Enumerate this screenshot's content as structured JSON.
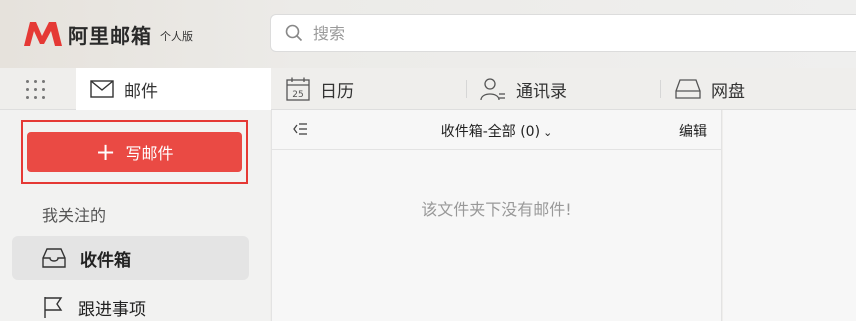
{
  "brand": {
    "name": "阿里邮箱",
    "edition": "个人版",
    "logo_color": "#e53935"
  },
  "search": {
    "placeholder": "搜索"
  },
  "tabs": [
    {
      "label": "邮件",
      "icon": "mail-icon",
      "active": true
    },
    {
      "label": "日历",
      "icon": "calendar-icon",
      "calendar_day": "25"
    },
    {
      "label": "通讯录",
      "icon": "contacts-icon"
    },
    {
      "label": "网盘",
      "icon": "drive-icon"
    }
  ],
  "sidebar": {
    "compose_label": "写邮件",
    "section_title": "我关注的",
    "items": [
      {
        "label": "收件箱",
        "icon": "inbox-icon",
        "active": true
      },
      {
        "label": "跟进事项",
        "icon": "flag-icon"
      }
    ]
  },
  "list": {
    "folder_title": "收件箱-全部 (0)",
    "edit_label": "编辑",
    "empty_message": "该文件夹下没有邮件!"
  },
  "colors": {
    "accent": "#ea4a44",
    "highlight_border": "#e53935"
  }
}
